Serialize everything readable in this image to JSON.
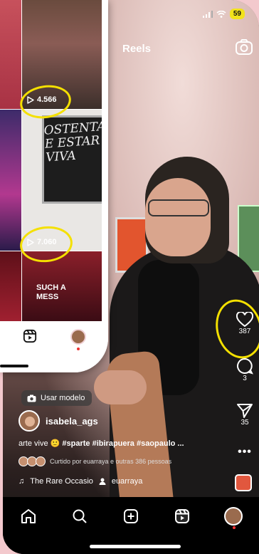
{
  "status_bar": {
    "battery": "59"
  },
  "reels": {
    "title": "Reels",
    "use_template": "Usar modelo",
    "username": "isabela_ags",
    "caption_prefix": "arte vive",
    "caption_tags": "#sparte #ibirapuera #saopaulo ...",
    "liked_by": "Curtido por euarraya e outras 386 pessoas",
    "song": "The Rare Occasio",
    "audio_user": "euarraya",
    "likes": "387",
    "comments": "3",
    "shares": "35"
  },
  "grid": {
    "views_1": "4.566",
    "views_2": "7.060",
    "mirror_text": "OSTENTAR E ESTAR VIVA",
    "tile_text": "SUCH A MESS"
  },
  "colors": {
    "highlight": "#f4e000",
    "battery": "#f2e21c"
  }
}
